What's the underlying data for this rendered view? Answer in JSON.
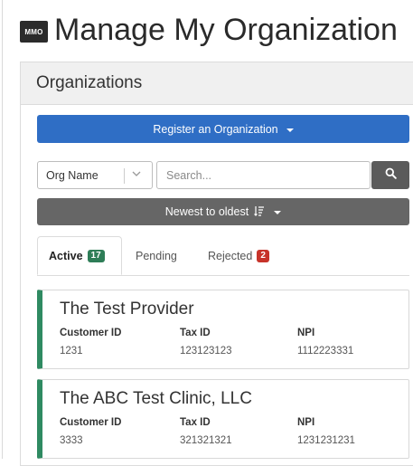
{
  "header": {
    "logo_text": "MMO",
    "title": "Manage My Organization"
  },
  "panel": {
    "title": "Organizations",
    "register_button": "Register an Organization",
    "filter_select": {
      "value": "Org Name"
    },
    "search": {
      "placeholder": "Search..."
    },
    "sort_button": "Newest to oldest"
  },
  "tabs": [
    {
      "label": "Active",
      "count": "17"
    },
    {
      "label": "Pending"
    },
    {
      "label": "Rejected",
      "count": "2"
    }
  ],
  "field_labels": {
    "customer_id": "Customer ID",
    "tax_id": "Tax ID",
    "npi": "NPI"
  },
  "organizations": [
    {
      "name": "The Test Provider",
      "customer_id": "1231",
      "tax_id": "123123123",
      "npi": "1112223331"
    },
    {
      "name": "The ABC Test Clinic, LLC",
      "customer_id": "3333",
      "tax_id": "321321321",
      "npi": "1231231231"
    }
  ],
  "colors": {
    "primary": "#2f6ec5",
    "secondary": "#666666",
    "active_accent": "#2f8a62",
    "rejected_badge": "#c7332a"
  }
}
